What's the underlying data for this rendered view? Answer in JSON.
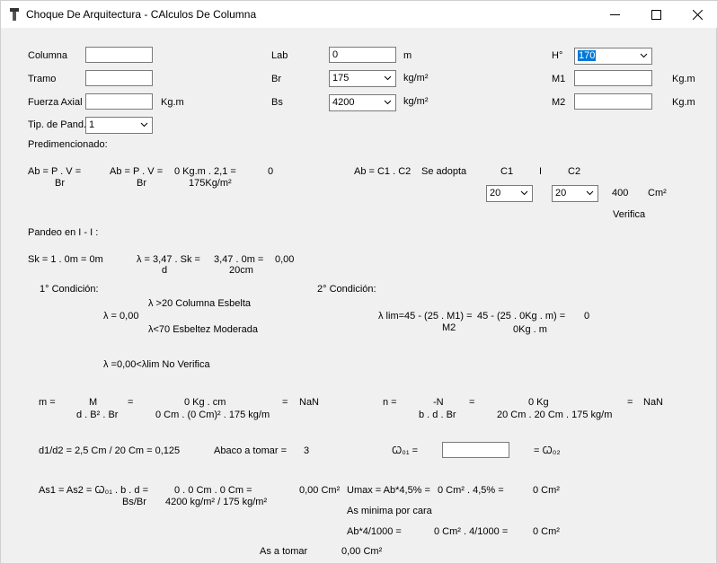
{
  "window": {
    "title": "Choque De Arquitectura - CAlculos De Columna"
  },
  "labels": {
    "columna": "Columna",
    "tramo": "Tramo",
    "fuerza_axial": "Fuerza Axial",
    "kgm1": "Kg.m",
    "tip_pand": "Tip. de Pand.",
    "predim": "Predimencionado:",
    "lab": "Lab",
    "m": "m",
    "br": "Br",
    "kgm2_a": "kg/m²",
    "bs": "Bs",
    "kgm2_b": "kg/m²",
    "h": "H°",
    "m1": "M1",
    "kgm_m1": "Kg.m",
    "m2": "M2",
    "kgm_m2": "Kg.m"
  },
  "fields": {
    "columna": "",
    "tramo": "",
    "fuerza_axial": "",
    "tip_pand": "1",
    "lab": "0",
    "br": "175",
    "bs": "4200",
    "h": "170",
    "m1": "",
    "m2": "",
    "c1": "20",
    "c2": "20",
    "omega": ""
  },
  "calc": {
    "ab1": "Ab = P . V =",
    "br1": "Br",
    "ab2": "Ab = P . V =",
    "br2": "Br",
    "ab_val": "0 Kg.m . 2,1 =",
    "ab_den": "175Kg/m²",
    "ab_res": "0",
    "ab_c": "Ab = C1 . C2",
    "se_adopta": "Se adopta",
    "c1": "C1",
    "sep": "I",
    "c2": "C2",
    "area": "400",
    "cm2": "Cm²",
    "verifica": "Verifica",
    "pandeo": "Pandeo en I - I :",
    "sk": "Sk = 1 . 0m = 0m",
    "lambda": "λ = 3,47 . Sk  =",
    "lambda_d": "d",
    "lambda_num": "3,47 . 0m  =",
    "lambda_den": "20cm",
    "lambda_res": "0,00",
    "cond1": "1° Condición:",
    "cond2": "2° Condición:",
    "esbelta": "λ >20 Columna Esbelta",
    "lambda0": "λ = 0,00",
    "moderada": "λ<70 Esbeltez Moderada",
    "lim": "λ lim=45 - (25 . M1)  =",
    "lim_den": "M2",
    "lim_num": "45 - (25 . 0Kg . m) =",
    "lim_den2": "0Kg . m",
    "lim_res": "0",
    "noverif": "λ =0,00<λlim No Verifica",
    "m_eq": "m =",
    "m_num": "M",
    "m_den": "d . B² . Br",
    "eq1": "=",
    "m_num2": "0 Kg . cm",
    "m_den2": "0 Cm . (0 Cm)² . 175 kg/m",
    "eq2": "=",
    "m_res": "NaN",
    "n_eq": "n =",
    "n_num": "-N",
    "n_den": "b . d . Br",
    "eq3": "=",
    "n_num2": "0 Kg",
    "n_den2": "20 Cm . 20 Cm . 175 kg/m",
    "eq4": "=",
    "n_res": "NaN",
    "d1d2": "d1/d2 = 2,5 Cm / 20 Cm = 0,125",
    "abaco": "Abaco a tomar =",
    "abaco_val": "3",
    "omega_lbl": "Ꞷ₀₁ =",
    "omega_eq": "= Ꞷ₀₂",
    "as1": "As1 = As2 = Ꞷ₀₁ . b . d   =",
    "as1_den": "Bs/Br",
    "as1_num": "0 . 0 Cm . 0 Cm =",
    "as1_den2": "4200 kg/m² / 175 kg/m²",
    "as1_res": "0,00 Cm²",
    "umax": "Umax = Ab*4,5% =",
    "umax_val": "0 Cm² . 4,5% =",
    "umax_res": "0 Cm²",
    "asmin": "As minima por cara",
    "ab4": "Ab*4/1000 =",
    "ab4_val": "0 Cm² . 4/1000 =",
    "ab4_res": "0 Cm²",
    "astomar": "As a tomar",
    "astomar_val": "0,00 Cm²"
  }
}
